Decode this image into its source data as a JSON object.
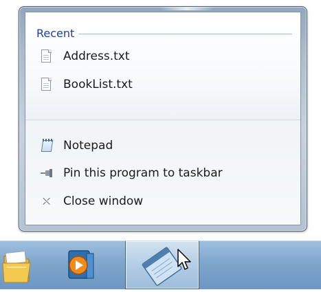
{
  "jumplist": {
    "recent": {
      "header": "Recent",
      "items": [
        {
          "label": "Address.txt",
          "icon": "text-document-icon"
        },
        {
          "label": "BookList.txt",
          "icon": "text-document-icon"
        }
      ]
    },
    "tasks": [
      {
        "label": "Notepad",
        "icon": "notepad-icon"
      },
      {
        "label": "Pin this program to taskbar",
        "icon": "pin-icon"
      },
      {
        "label": "Close window",
        "icon": "close-icon"
      }
    ]
  },
  "taskbar": {
    "buttons": [
      {
        "name": "Windows Explorer",
        "icon": "folder-icon"
      },
      {
        "name": "Windows Media Player",
        "icon": "media-player-icon"
      },
      {
        "name": "Notepad",
        "icon": "notepad-icon",
        "active": true
      }
    ]
  },
  "colors": {
    "header_text": "#1e3e9c",
    "taskbar": "#7fa6cc",
    "frame": "#a9bccd"
  }
}
